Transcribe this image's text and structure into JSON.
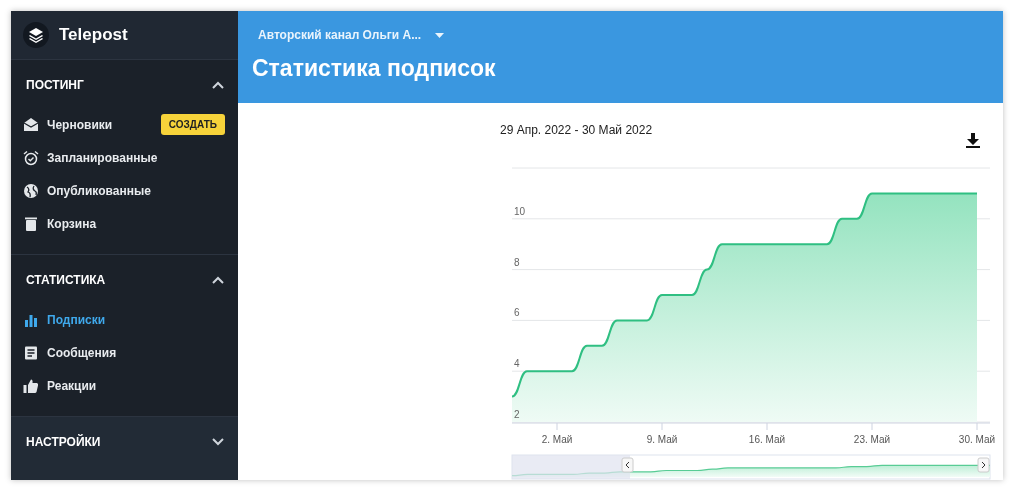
{
  "app": {
    "name": "Telepost"
  },
  "header": {
    "channel": "Авторский канал Ольги А...",
    "title": "Статистика подписок"
  },
  "sidebar": {
    "sections": [
      {
        "title": "ПОСТИНГ",
        "expanded": true,
        "items": [
          {
            "label": "Черновики",
            "selected": false,
            "action": "СОЗДАТЬ"
          },
          {
            "label": "Запланированные",
            "selected": false
          },
          {
            "label": "Опубликованные",
            "selected": false
          },
          {
            "label": "Корзина",
            "selected": false
          }
        ]
      },
      {
        "title": "СТАТИСТИКА",
        "expanded": true,
        "items": [
          {
            "label": "Подписки",
            "selected": true
          },
          {
            "label": "Сообщения",
            "selected": false
          },
          {
            "label": "Реакции",
            "selected": false
          }
        ]
      },
      {
        "title": "НАСТРОЙКИ",
        "expanded": false
      }
    ]
  },
  "stats": {
    "date_range": "29 Апр. 2022 - 30 Май 2022",
    "chart_data": {
      "type": "area",
      "categories": [
        null,
        null,
        null,
        "2. Май",
        null,
        null,
        null,
        null,
        null,
        null,
        "9. Май",
        null,
        null,
        null,
        null,
        null,
        null,
        "16. Май",
        null,
        null,
        null,
        null,
        null,
        null,
        "23. Май",
        null,
        null,
        null,
        null,
        null,
        null,
        "30. Май"
      ],
      "series": [
        {
          "color": "#2fbf82",
          "values": [
            3,
            4,
            4,
            4,
            4,
            5,
            5,
            6,
            6,
            6,
            7,
            7,
            7,
            8,
            9,
            9,
            9,
            9,
            9,
            9,
            9,
            9,
            10,
            10,
            11,
            11,
            11,
            11,
            11,
            11,
            11,
            11
          ]
        }
      ],
      "ylim": [
        2,
        12
      ],
      "yticks": [
        2,
        4,
        6,
        8,
        10
      ],
      "grid": true
    }
  }
}
